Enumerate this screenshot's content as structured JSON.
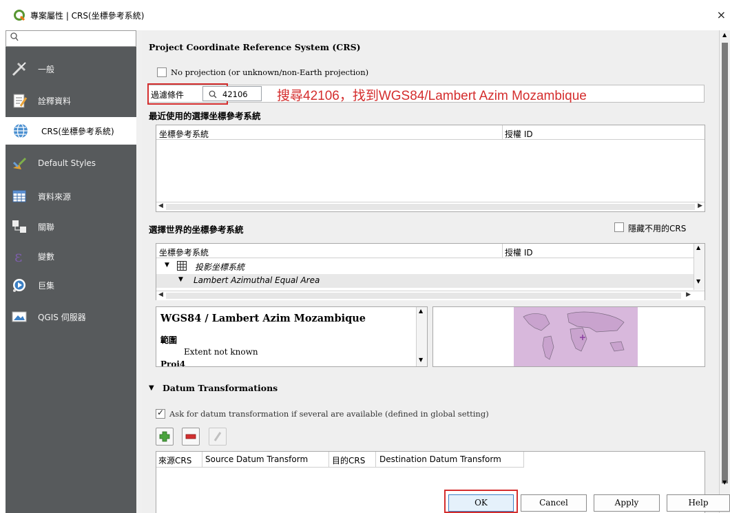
{
  "window": {
    "title": "專案屬性 | CRS(坐標參考系統)",
    "close_glyph": "×"
  },
  "sidebar": {
    "search_glyph": "🔍",
    "items": [
      {
        "label": "一般",
        "icon": "tools-icon"
      },
      {
        "label": "詮釋資料",
        "icon": "metadata-icon"
      },
      {
        "label": "CRS(坐標參考系統)",
        "icon": "globe-icon"
      },
      {
        "label": "Default Styles",
        "icon": "brush-icon"
      },
      {
        "label": "資料來源",
        "icon": "table-icon"
      },
      {
        "label": "關聯",
        "icon": "relations-icon"
      },
      {
        "label": "變數",
        "icon": "epsilon-icon"
      },
      {
        "label": "巨集",
        "icon": "macro-icon"
      },
      {
        "label": "QGIS 伺服器",
        "icon": "server-icon"
      }
    ]
  },
  "crs": {
    "section_title": "Project Coordinate Reference System (CRS)",
    "no_projection_label": "No projection (or unknown/non-Earth projection)",
    "filter_label": "過濾條件",
    "filter_value": "42106",
    "annotation": "搜尋42106，找到WGS84/Lambert Azim Mozambique",
    "recent_title": "最近使用的選擇坐標參考系統",
    "col_crs": "坐標參考系統",
    "col_auth": "授權 ID",
    "world_title": "選擇世界的坐標參考系統",
    "hide_deprecated_label": "隱藏不用的CRS",
    "tree_group": "投影坐標系統",
    "tree_child": "Lambert Azimuthal Equal Area",
    "selected_name": "WGS84 / Lambert Azim Mozambique",
    "extent_heading": "範圍",
    "extent_text": "Extent not known",
    "proj4_heading": "Proj4"
  },
  "datum": {
    "section_title": "Datum Transformations",
    "ask_label": "Ask for datum transformation if several are available (defined in global setting)",
    "columns": [
      "來源CRS",
      "Source Datum Transform",
      "目的CRS",
      "Destination Datum Transform"
    ]
  },
  "buttons": {
    "ok": "OK",
    "cancel": "Cancel",
    "apply": "Apply",
    "help": "Help"
  },
  "colors": {
    "sidebar_bg": "#575a5c",
    "annotation_red": "#d42d2d",
    "map_fill": "#d8b8dc"
  }
}
